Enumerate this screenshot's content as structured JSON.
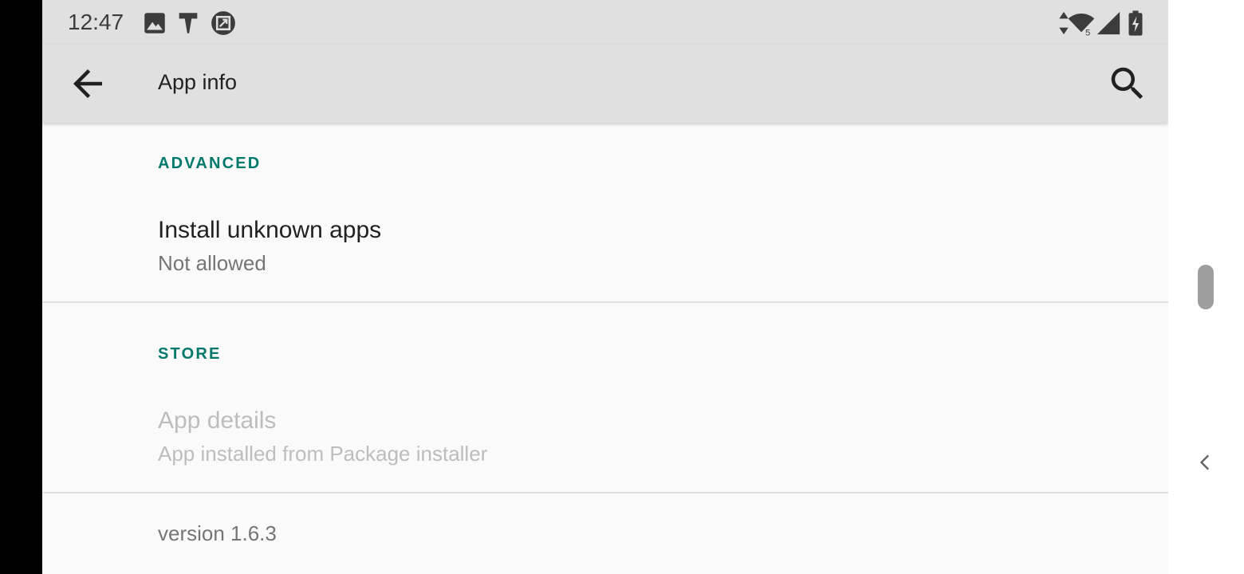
{
  "status_bar": {
    "time": "12:47",
    "left_icons": [
      "image-icon",
      "t-notification-icon",
      "screenshot-icon"
    ],
    "right_icons": [
      "data-arrows-icon",
      "wifi-icon",
      "cell-signal-icon",
      "battery-charging-icon"
    ],
    "wifi_badge": "5"
  },
  "app_bar": {
    "title": "App info",
    "back_icon": "arrow-back-icon",
    "search_icon": "search-icon"
  },
  "sections": {
    "advanced": {
      "header": "ADVANCED",
      "item": {
        "title": "Install unknown apps",
        "summary": "Not allowed"
      }
    },
    "store": {
      "header": "STORE",
      "item": {
        "title": "App details",
        "summary": "App installed from Package installer"
      }
    }
  },
  "footer": {
    "version": "version 1.6.3"
  },
  "colors": {
    "accent": "#00796b",
    "app_bar_bg": "#e0e0e0",
    "background": "#fafafa",
    "primary_text": "#212121",
    "secondary_text": "#757575",
    "disabled_text": "#bdbdbd"
  }
}
